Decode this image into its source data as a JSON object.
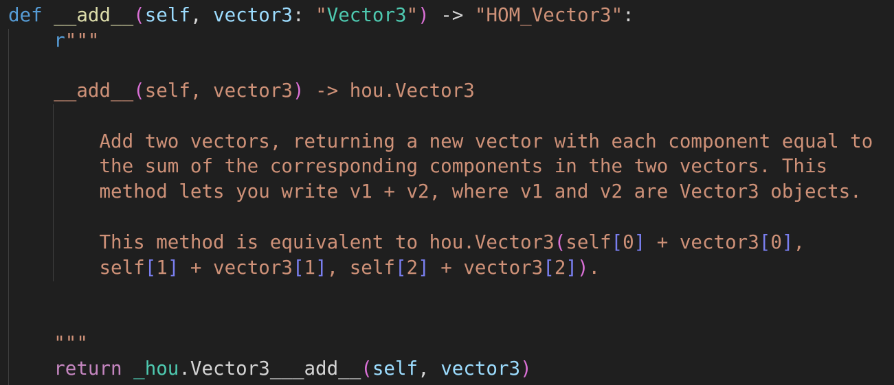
{
  "code": {
    "line1": {
      "kw_def": "def",
      "fn_name": "__add__",
      "open_paren": "(",
      "self": "self",
      "comma": ",",
      "param_vector3": "vector3",
      "colon": ":",
      "quote_open": "\"",
      "type_vector3": "Vector3",
      "quote_close": "\"",
      "close_paren": ")",
      "arrow": "->",
      "return_type": "\"HOM_Vector3\"",
      "end_colon": ":"
    },
    "line2": {
      "prefix": "r",
      "triple_quote": "\"\"\""
    },
    "line4": {
      "fn_name": "__add__",
      "rest_open": "(",
      "args": "self, vector3",
      "rest_close": ")",
      "arrow_type": " -> hou.Vector3"
    },
    "doc": {
      "line1": "Add two vectors, returning a new vector with each component equal to",
      "line2": "the sum of the corresponding components in the two vectors. This",
      "line3": "method lets you write v1 + v2, where v1 and v2 are Vector3 objects.",
      "line5_a": "This method is equivalent to hou.Vector3",
      "line5_p": "(",
      "line5_b": "self",
      "line5_br1": "[",
      "line5_n1": "0",
      "line5_br2": "]",
      "line5_c": " + vector3",
      "line5_br3": "[",
      "line5_n2": "0",
      "line5_br4": "]",
      "line5_d": ",",
      "line6_a": "self",
      "line6_br1": "[",
      "line6_n1": "1",
      "line6_br2": "]",
      "line6_b": " + vector3",
      "line6_br3": "[",
      "line6_n2": "1",
      "line6_br4": "]",
      "line6_c": ", self",
      "line6_br5": "[",
      "line6_n3": "2",
      "line6_br6": "]",
      "line6_d": " + vector3",
      "line6_br7": "[",
      "line6_n4": "2",
      "line6_br8": "]",
      "line6_p": ")",
      "line6_e": "."
    },
    "line_close_quote": "\"\"\"",
    "return_line": {
      "kw_return": "return",
      "module": "_hou",
      "dot_name": ".Vector3___add__",
      "open_paren": "(",
      "self": "self",
      "comma": ",",
      "arg": "vector3",
      "close_paren": ")"
    }
  },
  "colors": {
    "background": "#1f1f1f",
    "keyword": "#569cd6",
    "function": "#dcdcaa",
    "string": "#ce9178",
    "parameter": "#9cdcfe",
    "class": "#4ec9b0",
    "paren": "#da70d6",
    "bracket": "#7a7ff0",
    "control": "#c586c0",
    "indent_guide": "#404040"
  }
}
